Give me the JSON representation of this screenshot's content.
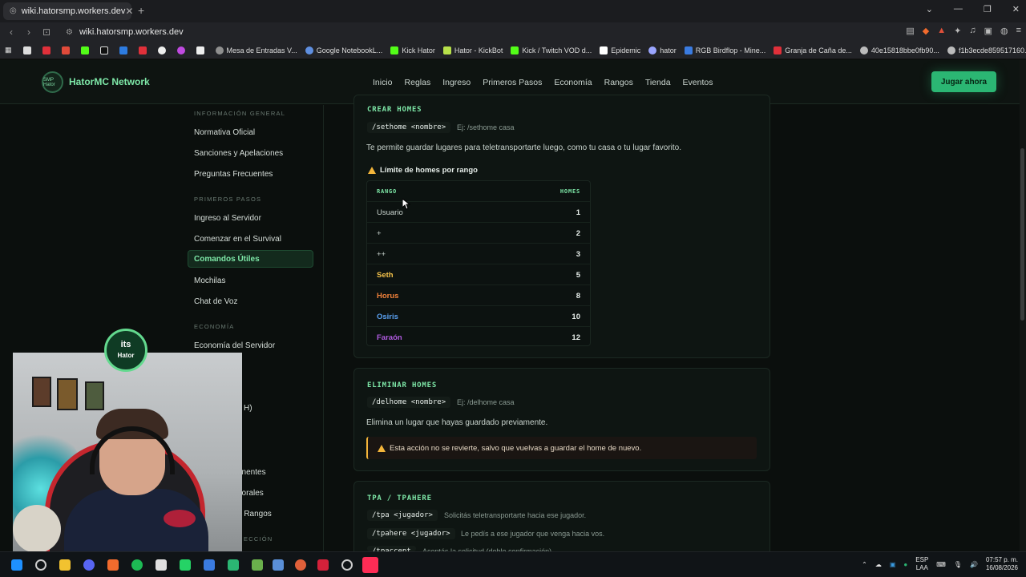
{
  "browser": {
    "tab_title": "wiki.hatorsmp.workers.dev",
    "address": "wiki.hatorsmp.workers.dev",
    "bookmarks": [
      {
        "label": "Mesa de Entradas V...",
        "color": "#8f8f8f"
      },
      {
        "label": "Google NotebookL...",
        "color": "#5f8fe0"
      },
      {
        "label": "Kick Hator",
        "color": "#53fc18"
      },
      {
        "label": "Hator - KickBot",
        "color": "#b7e04a"
      },
      {
        "label": "Kick / Twitch VOD d...",
        "color": "#53fc18"
      },
      {
        "label": "Epidemic",
        "color": "#ffffff"
      },
      {
        "label": "hator",
        "color": "#9aa5ff"
      },
      {
        "label": "RGB Birdflop - Mine...",
        "color": "#3a7be0"
      },
      {
        "label": "Granja de Caña de...",
        "color": "#e0303a"
      },
      {
        "label": "40e15818bbe0fb90...",
        "color": "#bbbbbb"
      },
      {
        "label": "f1b3ecde859517160...",
        "color": "#bbbbbb"
      }
    ]
  },
  "site": {
    "brand": "HatorMC Network",
    "logo_text": "SMP Hator",
    "nav": [
      "Inicio",
      "Reglas",
      "Ingreso",
      "Primeros Pasos",
      "Economía",
      "Rangos",
      "Tienda",
      "Eventos"
    ],
    "play_button": "Jugar ahora"
  },
  "sidebar": {
    "section1": "INFORMACIÓN GENERAL",
    "items1": [
      "Normativa Oficial",
      "Sanciones y Apelaciones",
      "Preguntas Frecuentes"
    ],
    "section2": "PRIMEROS PASOS",
    "items2": [
      "Ingreso al Servidor",
      "Comenzar en el Survival",
      "Comandos Útiles",
      "Mochilas",
      "Chat de Voz"
    ],
    "section3": "ECONOMÍA",
    "items3": [
      "Economía del Servidor"
    ],
    "partial": [
      "H)",
      "anentes",
      "porales",
      "e Rangos",
      "ECCIÓN"
    ]
  },
  "homes": {
    "title": "CREAR HOMES",
    "command": "/sethome <nombre>",
    "example": "Ej: /sethome casa",
    "description": "Te permite guardar lugares para teletransportarte luego, como tu casa o tu lugar favorito.",
    "limit_title": "Límite de homes por rango",
    "col_rank": "RANGO",
    "col_homes": "HOMES",
    "rows": [
      {
        "rank": "Usuario",
        "homes": "1",
        "color": "#c9d4ce"
      },
      {
        "rank": "+",
        "homes": "2",
        "color": "#c9d4ce"
      },
      {
        "rank": "++",
        "homes": "3",
        "color": "#c9d4ce"
      },
      {
        "rank": "Seth",
        "homes": "5",
        "color": "#f3c14a"
      },
      {
        "rank": "Horus",
        "homes": "8",
        "color": "#f0813a"
      },
      {
        "rank": "Osiris",
        "homes": "10",
        "color": "#5aa0f0"
      },
      {
        "rank": "Faraón",
        "homes": "12",
        "color": "#b05be0"
      }
    ]
  },
  "delete": {
    "title": "ELIMINAR HOMES",
    "command": "/delhome <nombre>",
    "example": "Ej: /delhome casa",
    "description": "Elimina un lugar que hayas guardado previamente.",
    "warning": "Esta acción no se revierte, salvo que vuelvas a guardar el home de nuevo."
  },
  "tpa": {
    "title": "TPA / TPAHERE",
    "cmd1": "/tpa <jugador>",
    "desc1": "Solicitás teletransportarte hacia ese jugador.",
    "cmd2": "/tpahere <jugador>",
    "desc2": "Le pedís a ese jugador que venga hacia vos.",
    "cmd3": "/tpaccept",
    "desc3": "Aceptás la solicitud (doble confirmación)."
  },
  "webcam": {
    "badge_top": "its",
    "badge_bottom": "Hator"
  },
  "taskbar": {
    "lang_top": "ESP",
    "lang_bottom": "LAA",
    "time": "07:57 p. m.",
    "date": "16/08/2026"
  }
}
